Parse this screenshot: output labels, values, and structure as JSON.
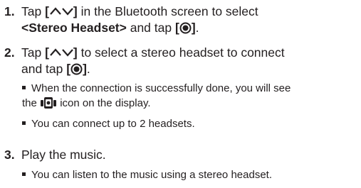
{
  "steps": [
    {
      "number": "1.",
      "line1_pre": "Tap ",
      "line1_icon_left": "[",
      "line1_icon_right": "]",
      "line1_post": " in the Bluetooth screen to select",
      "line2_bold": "<Stereo Headset>",
      "line2_mid": " and tap ",
      "line2_icon_left": "[",
      "line2_icon_right": "]",
      "line2_end": "."
    },
    {
      "number": "2.",
      "line1_pre": "Tap ",
      "line1_icon_left": "[",
      "line1_icon_right": "]",
      "line1_post": " to select a stereo headset to connect",
      "line2_pre": "and tap ",
      "line2_icon_left": "[",
      "line2_icon_right": "]",
      "line2_end": ".",
      "bullets": [
        {
          "line1": "When the connection is successfully done, you will see",
          "line2_pre": "the ",
          "line2_post": " icon on the display."
        },
        {
          "line1": "You can connect up to 2 headsets."
        }
      ]
    },
    {
      "number": "3.",
      "text": "Play the music.",
      "bullets": [
        {
          "line1": "You can listen to the music using a stereo headset."
        }
      ]
    }
  ],
  "icons": {
    "up_down_arrows": "up-down-arrows-icon",
    "select_button": "select-button-icon",
    "headset": "stereo-headset-icon"
  }
}
